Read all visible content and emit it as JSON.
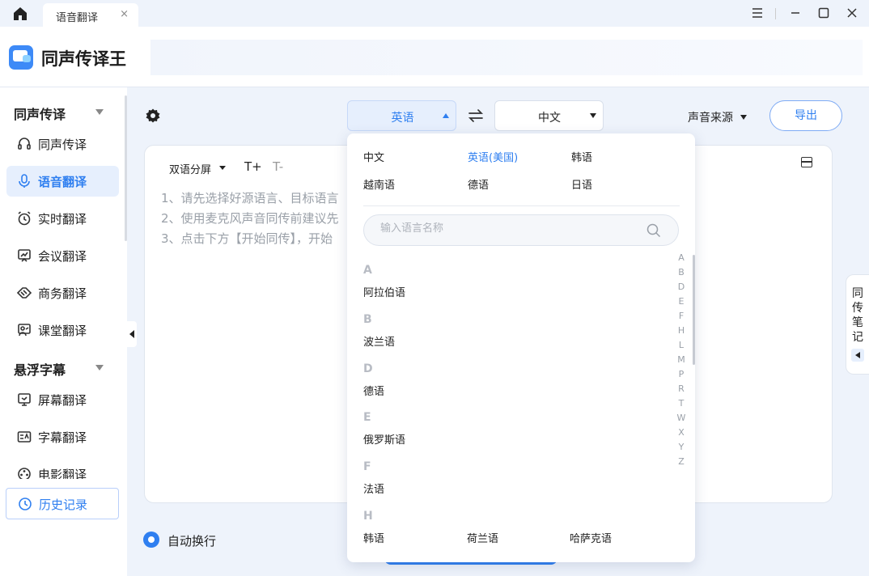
{
  "titlebar": {
    "tab_label": "语音翻译",
    "tab_close": "×"
  },
  "app": {
    "title": "同声传译王",
    "accent_color": "#2f7ff0"
  },
  "sidebar": {
    "sections": [
      {
        "title": "同声传译",
        "items": [
          {
            "label": "同声传译",
            "icon": "headset-icon",
            "active": false
          },
          {
            "label": "语音翻译",
            "icon": "microphone-icon",
            "active": true
          },
          {
            "label": "实时翻译",
            "icon": "alarm-clock-icon",
            "active": false
          },
          {
            "label": "会议翻译",
            "icon": "presentation-icon",
            "active": false
          },
          {
            "label": "商务翻译",
            "icon": "handshake-icon",
            "active": false
          },
          {
            "label": "课堂翻译",
            "icon": "teacher-icon",
            "active": false
          }
        ]
      },
      {
        "title": "悬浮字幕",
        "items": [
          {
            "label": "屏幕翻译",
            "icon": "monitor-icon"
          },
          {
            "label": "字幕翻译",
            "icon": "subtitle-icon"
          },
          {
            "label": "电影翻译",
            "icon": "film-reel-icon"
          }
        ]
      }
    ],
    "history_label": "历史记录"
  },
  "toolbar": {
    "source_lang": "英语",
    "target_lang": "中文",
    "voice_source": "声音来源",
    "export_label": "导出"
  },
  "panel": {
    "split_label": "双语分屏",
    "font_up": "T+",
    "font_down": "T-",
    "tips": [
      "1、请先选择好源语言、目标语言",
      "2、使用麦克风声音同传前建议先",
      "3、点击下方【开始同传】，开始"
    ]
  },
  "bottom": {
    "auto_wrap": "自动换行"
  },
  "notes": {
    "label": "同传笔记"
  },
  "dropdown": {
    "recent": [
      "中文",
      "英语(美国)",
      "韩语",
      "越南语",
      "德语",
      "日语"
    ],
    "search_placeholder": "输入语言名称",
    "groups": [
      {
        "letter": "A",
        "items": [
          "阿拉伯语"
        ]
      },
      {
        "letter": "B",
        "items": [
          "波兰语"
        ]
      },
      {
        "letter": "D",
        "items": [
          "德语"
        ]
      },
      {
        "letter": "E",
        "items": [
          "俄罗斯语"
        ]
      },
      {
        "letter": "F",
        "items": [
          "法语"
        ]
      },
      {
        "letter": "H",
        "items": [
          "韩语",
          "荷兰语",
          "哈萨克语"
        ]
      }
    ],
    "alphabet": [
      "A",
      "B",
      "D",
      "E",
      "F",
      "H",
      "L",
      "M",
      "P",
      "R",
      "T",
      "W",
      "X",
      "Y",
      "Z"
    ]
  }
}
